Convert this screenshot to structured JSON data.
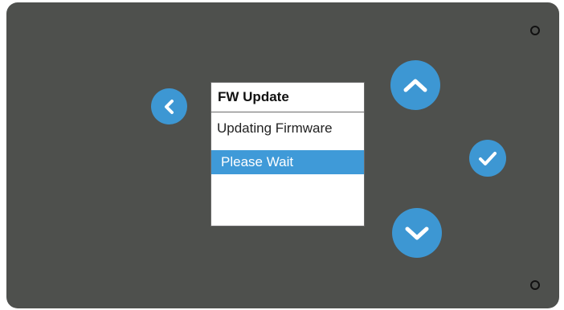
{
  "device": {
    "screen": {
      "title": "FW Update",
      "line1": "Updating Firmware",
      "highlight": "Please Wait"
    },
    "buttons": {
      "back_icon": "chevron-left-icon",
      "up_icon": "chevron-up-icon",
      "ok_icon": "check-icon",
      "down_icon": "chevron-down-icon"
    },
    "colors": {
      "panel": "#4e504d",
      "button": "#3d97d3",
      "highlight": "#3f9ad8"
    }
  }
}
